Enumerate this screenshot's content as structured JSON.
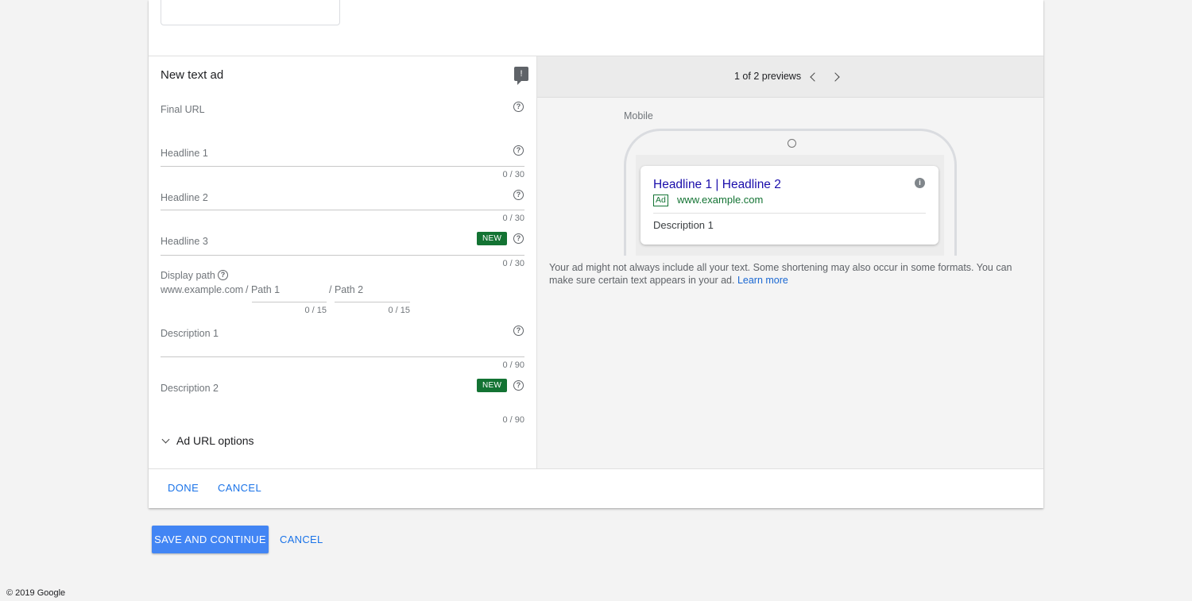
{
  "editor": {
    "title": "New text ad",
    "fields": {
      "final_url": {
        "label": "Final URL"
      },
      "headline1": {
        "label": "Headline 1",
        "counter": "0 / 30"
      },
      "headline2": {
        "label": "Headline 2",
        "counter": "0 / 30"
      },
      "headline3": {
        "label": "Headline 3",
        "counter": "0 / 30",
        "badge": "NEW"
      },
      "display_path": {
        "label": "Display path",
        "domain": "www.example.com",
        "path1_label": "/ Path 1",
        "path2_label": "/ Path 2",
        "path1_counter": "0 / 15",
        "path2_counter": "0 / 15"
      },
      "description1": {
        "label": "Description 1",
        "counter": "0 / 90"
      },
      "description2": {
        "label": "Description 2",
        "counter": "0 / 90",
        "badge": "NEW"
      }
    },
    "ad_url_options": "Ad URL options",
    "help_glyph": "?",
    "feedback_icon": "feedback-icon"
  },
  "preview": {
    "count_text": "1 of 2 previews",
    "device_label": "Mobile",
    "ad": {
      "headline": "Headline 1 | Headline 2",
      "badge": "Ad",
      "url": "www.example.com",
      "description": "Description 1",
      "info_glyph": "i"
    },
    "note": "Your ad might not always include all your text. Some shortening may also occur in some formats. You can make sure certain text appears in your ad.",
    "learn_more": "Learn more"
  },
  "footer": {
    "done": "DONE",
    "cancel": "CANCEL",
    "save_continue": "SAVE AND CONTINUE",
    "cancel2": "CANCEL"
  },
  "copyright": "© 2019 Google",
  "colors": {
    "primary_blue": "#1a73e8",
    "button_blue": "#4285f4",
    "badge_green": "#137333",
    "ad_headline": "#1a0dab"
  }
}
